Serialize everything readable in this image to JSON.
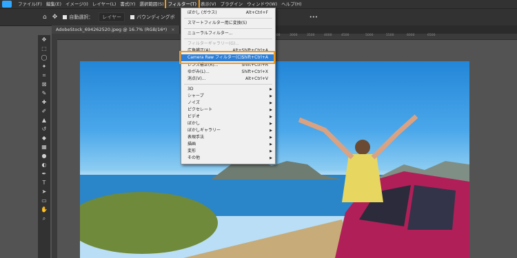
{
  "menubar": {
    "items": [
      "ファイル(F)",
      "編集(E)",
      "イメージ(I)",
      "レイヤー(L)",
      "書式(Y)",
      "選択範囲(S)",
      "フィルター(T)",
      "表示(V)",
      "プラグイン",
      "ウィンドウ(W)",
      "ヘルプ(H)"
    ],
    "active_index": 6
  },
  "options": {
    "auto_select_label": "自動選択：",
    "layer_dropdown": "レイヤー",
    "bounding_label": "バウンディングボ",
    "more": "•••"
  },
  "document_tab": {
    "title": "AdobeStock_694262520.jpeg @ 16.7% (RGB/16*)",
    "close": "×"
  },
  "ruler_ticks": [
    "2500",
    "3000",
    "3500",
    "4000",
    "4500",
    "5000",
    "5500",
    "6000",
    "6500"
  ],
  "filter_menu": [
    {
      "label": "ぼかし (ガウス)",
      "shortcut": "Alt+Ctrl+F"
    },
    {
      "label": "スマートフィルター用に変換(S)"
    },
    {
      "label": "ニューラルフィルター..."
    },
    {
      "label": "フィルターギャラリー(G)...",
      "disabled": true
    },
    {
      "label": "広角補正(A)...",
      "shortcut": "Alt+Shift+Ctrl+A"
    },
    {
      "label": "Camera Raw フィルター(C)...",
      "shortcut": "Shift+Ctrl+A",
      "highlighted": true
    },
    {
      "label": "レンズ補正(R)...",
      "shortcut": "Shift+Ctrl+R"
    },
    {
      "label": "ゆがみ(L)...",
      "shortcut": "Shift+Ctrl+X"
    },
    {
      "label": "消点(V)...",
      "shortcut": "Alt+Ctrl+V"
    },
    {
      "label": "3D",
      "submenu": true
    },
    {
      "label": "シャープ",
      "submenu": true
    },
    {
      "label": "ノイズ",
      "submenu": true
    },
    {
      "label": "ピクセレート",
      "submenu": true
    },
    {
      "label": "ビデオ",
      "submenu": true
    },
    {
      "label": "ぼかし",
      "submenu": true
    },
    {
      "label": "ぼかしギャラリー",
      "submenu": true
    },
    {
      "label": "表現手法",
      "submenu": true
    },
    {
      "label": "描画",
      "submenu": true
    },
    {
      "label": "変形",
      "submenu": true
    },
    {
      "label": "その他",
      "submenu": true
    }
  ],
  "tools": [
    "move-icon",
    "marquee-icon",
    "lasso-icon",
    "magic-wand-icon",
    "crop-icon",
    "frame-icon",
    "eyedropper-icon",
    "healing-icon",
    "brush-icon",
    "stamp-icon",
    "history-brush-icon",
    "eraser-icon",
    "gradient-icon",
    "blur-icon",
    "dodge-icon",
    "pen-icon",
    "type-icon",
    "path-select-icon",
    "shape-icon",
    "hand-icon",
    "zoom-icon"
  ],
  "colors": {
    "highlight_box": "#f19a1d",
    "menu_highlight": "#2f7fd6",
    "app_bg": "#535353"
  }
}
